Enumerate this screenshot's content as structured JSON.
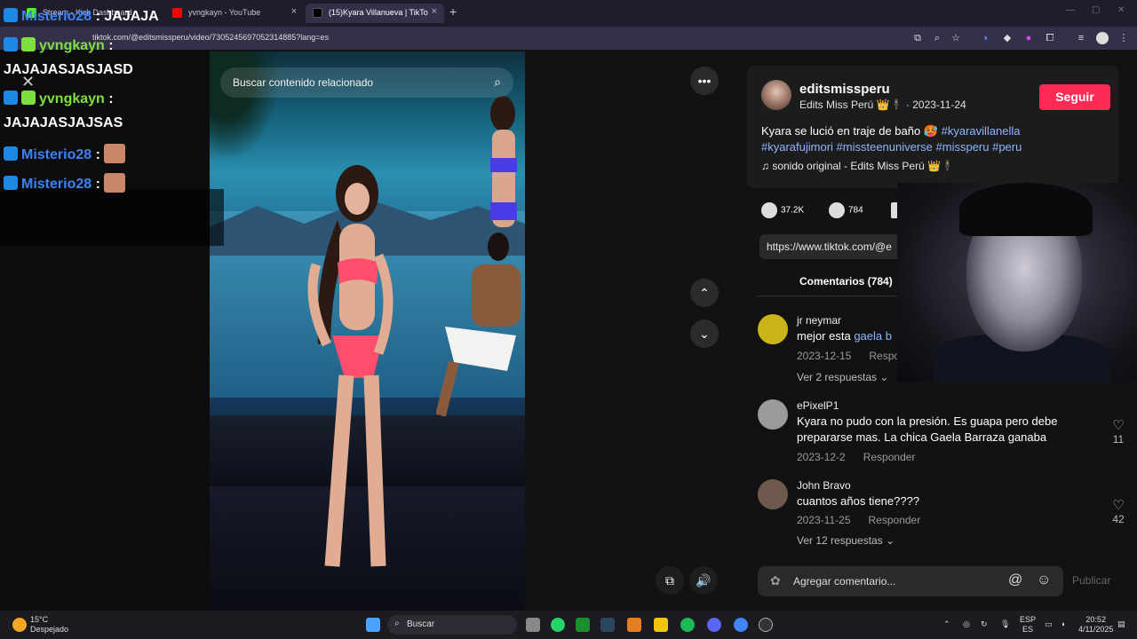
{
  "browser": {
    "tabs": [
      {
        "label": "Stream - Kick Dashboard",
        "color": "#53fc18"
      },
      {
        "label": "yvngkayn - YouTube",
        "color": "#ff0000"
      },
      {
        "label": "(15)Kyara Villanueva | TikTo",
        "color": "#000000"
      }
    ],
    "url": "tiktok.com/@editsmissperu/video/7305245697052314885?lang=es"
  },
  "chat": {
    "messages": [
      {
        "user": "Misterio28",
        "sep": " : ",
        "text": "JAJAJA",
        "user_color": "#3b82f6"
      },
      {
        "user": "yvngkayn",
        "sep": " :",
        "text": "",
        "user_color": "#7ee03e"
      },
      {
        "user": "",
        "sep": "",
        "text": "JAJAJASJASJASD",
        "user_color": "#ffffff"
      },
      {
        "user": "yvngkayn",
        "sep": " :",
        "text": "",
        "user_color": "#7ee03e"
      },
      {
        "user": "",
        "sep": "",
        "text": "JAJAJASJAJSAS",
        "user_color": "#ffffff"
      },
      {
        "user": "Misterio28",
        "sep": " : ",
        "text": "",
        "user_color": "#3b82f6"
      },
      {
        "user": "Misterio28",
        "sep": " : ",
        "text": "",
        "user_color": "#3b82f6"
      }
    ]
  },
  "video": {
    "search_placeholder": "Buscar contenido relacionado"
  },
  "post": {
    "username": "editsmissperu",
    "subline": "Edits Miss Perú 👑🕴 · 2023-11-24",
    "follow_label": "Seguir",
    "desc_plain": "Kyara se lució en traje de baño 🥵 ",
    "tag1": "#kyaravillanella",
    "tags_line2": "#kyarafujimori #missteenuniverse #missperu #peru",
    "sound": "♫  sonido original - Edits Miss Perú 👑🕴",
    "likes": "37.2K",
    "comments_count": "784",
    "link": "https://www.tiktok.com/@e",
    "comments_tab": "Comentarios (784)"
  },
  "comments": [
    {
      "name": "jr neymar",
      "text": "mejor esta ",
      "mention": "gaela b",
      "date": "2023-12-15",
      "reply": "Respon",
      "likes": "",
      "more": "Ver 2 respuestas ⌄",
      "avatar": "#c9b51a"
    },
    {
      "name": "ePixelP1",
      "text": "Kyara no pudo con la presión. Es guapa pero debe prepararse mas. La chica Gaela Barraza ganaba",
      "mention": "",
      "date": "2023-12-2",
      "reply": "Responder",
      "likes": "11",
      "more": "",
      "avatar": "#9a9a9a"
    },
    {
      "name": "John Bravo",
      "text": "cuantos años tiene????",
      "mention": "",
      "date": "2023-11-25",
      "reply": "Responder",
      "likes": "42",
      "more": "Ver 12 respuestas ⌄",
      "avatar": "#6d5a4d"
    }
  ],
  "composer": {
    "placeholder": "Agregar comentario...",
    "publish": "Publicar"
  },
  "taskbar": {
    "weather_temp": "15°C",
    "weather_desc": "Despejado",
    "search": "Buscar",
    "lang_top": "ESP",
    "lang_bottom": "ES",
    "time": "20:52",
    "date": "4/11/2025"
  }
}
